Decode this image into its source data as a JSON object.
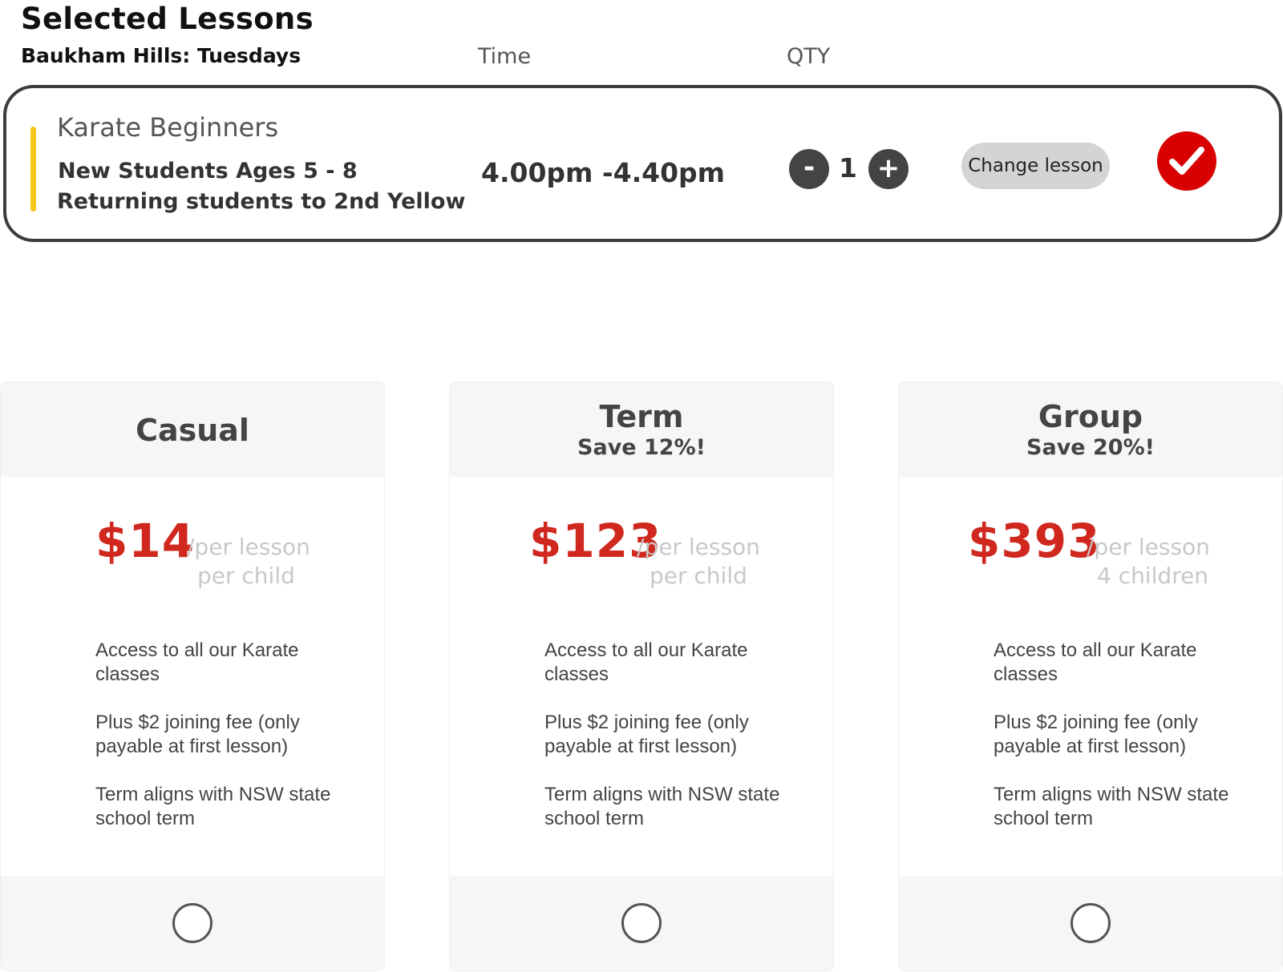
{
  "header": {
    "title": "Selected Lessons",
    "location": "Baukham Hills: Tuesdays",
    "col_time": "Time",
    "col_qty": "QTY"
  },
  "lesson": {
    "name": "Karate Beginners",
    "line1": "New Students Ages 5 - 8",
    "line2": "Returning students to 2nd Yellow",
    "time": "4.00pm -4.40pm",
    "qty_minus": "-",
    "qty": "1",
    "qty_plus": "+",
    "change_label": "Change lesson",
    "accent_color": "#f5c518",
    "selected_color": "#d80000",
    "check_icon": "check-icon"
  },
  "plans": [
    {
      "name": "Casual",
      "save": "",
      "price": "$14",
      "unit_line1": "/per lesson",
      "unit_line2": "per child",
      "features": [
        "Access to all our Karate classes",
        "Plus $2 joining fee (only payable at first lesson)",
        "Term aligns with NSW state school term"
      ],
      "selected": false
    },
    {
      "name": "Term",
      "save": "Save 12%!",
      "price": "$123",
      "unit_line1": "/per lesson",
      "unit_line2": "per child",
      "features": [
        "Access to all our Karate classes",
        "Plus $2 joining fee (only payable at first lesson)",
        "Term aligns with NSW state school term"
      ],
      "selected": false
    },
    {
      "name": "Group",
      "save": "Save 20%!",
      "price": "$393",
      "unit_line1": "/per lesson",
      "unit_line2": "4 children",
      "features": [
        "Access to all our Karate classes",
        "Plus $2 joining fee (only payable at first lesson)",
        "Term aligns with NSW state school term"
      ],
      "selected": false
    }
  ],
  "colors": {
    "price": "#d0281e",
    "muted": "#c8c8c8"
  }
}
